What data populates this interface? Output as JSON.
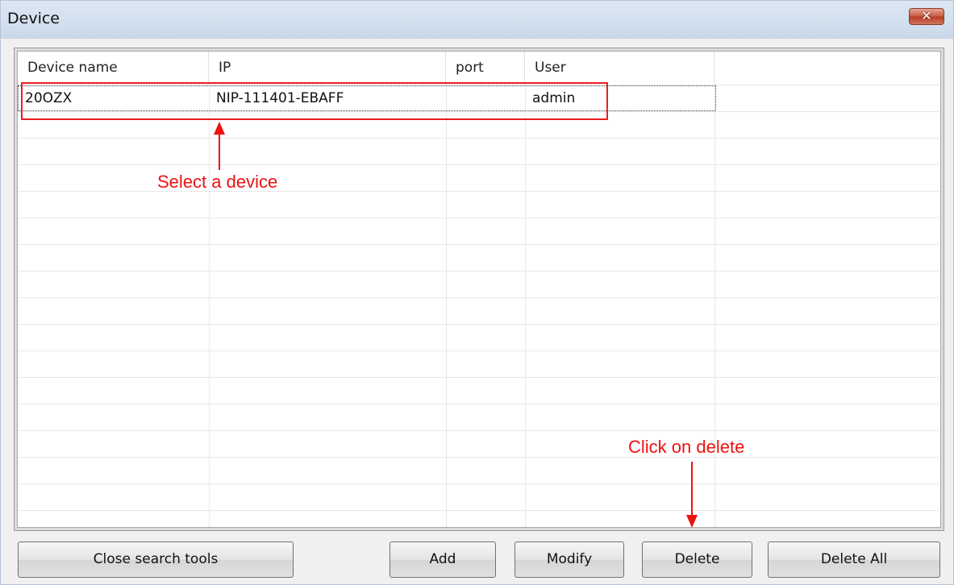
{
  "window": {
    "title": "Device",
    "close_symbol": "✕"
  },
  "table": {
    "columns": [
      "Device name",
      "IP",
      "port",
      "User"
    ],
    "rows": [
      {
        "device_name": "20OZX",
        "ip": "NIP-111401-EBAFF",
        "port": "",
        "user": "admin"
      }
    ]
  },
  "annotations": {
    "select_device": "Select a device",
    "click_delete": "Click on delete",
    "color": "#ee1111"
  },
  "buttons": {
    "close_search_tools": "Close search tools",
    "add": "Add",
    "modify": "Modify",
    "delete": "Delete",
    "delete_all": "Delete All"
  }
}
